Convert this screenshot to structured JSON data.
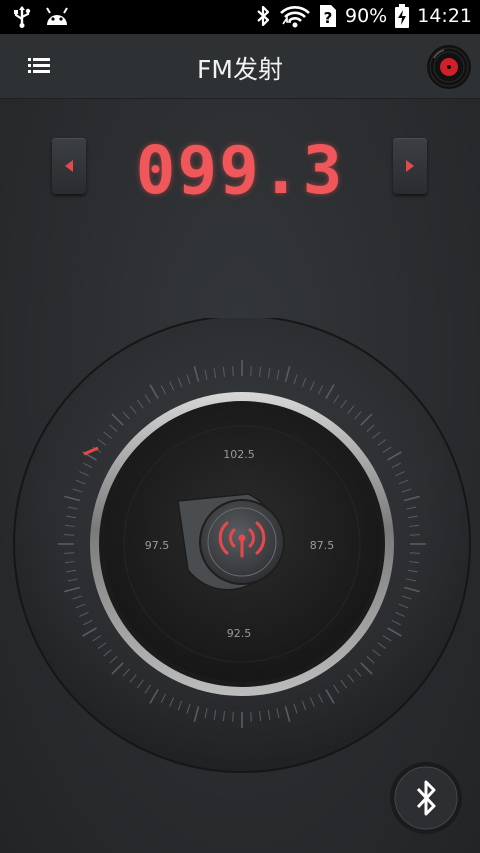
{
  "status": {
    "battery_percent": "90%",
    "time": "14:21",
    "icons": [
      "usb-icon",
      "android-icon",
      "bluetooth-icon",
      "wifi-icon",
      "sim-unknown-icon",
      "battery-charging-icon"
    ]
  },
  "appbar": {
    "title": "FM发射",
    "menu_icon": "menu-icon",
    "vinyl_icon": "vinyl-record-icon"
  },
  "tuner": {
    "frequency": "099.3",
    "prev_icon": "arrow-left-icon",
    "next_icon": "arrow-right-icon"
  },
  "dial": {
    "labels": {
      "top": "102.5",
      "right": "87.5",
      "bottom": "92.5",
      "left": "97.5"
    },
    "center_icon": "broadcast-antenna-icon"
  },
  "bluetooth_button_icon": "bluetooth-icon",
  "colors": {
    "accent": "#f0575a",
    "background": "#2b2e31",
    "statusbar": "#000000"
  }
}
